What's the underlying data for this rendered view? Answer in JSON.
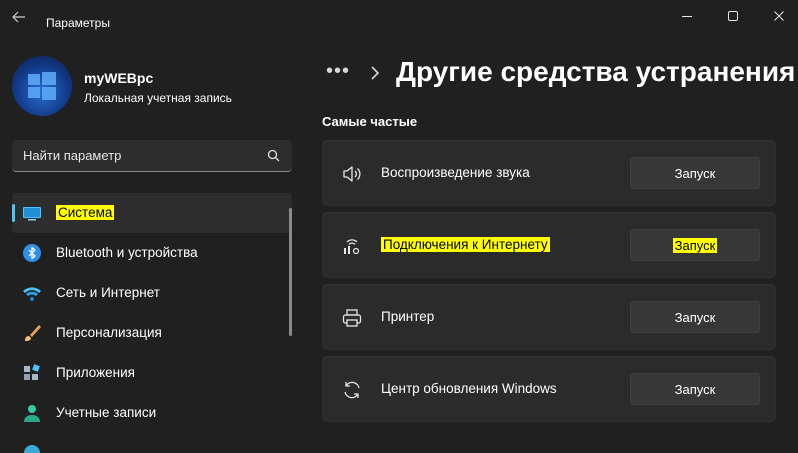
{
  "window": {
    "title": "Параметры"
  },
  "user": {
    "name": "myWEBpc",
    "account_type": "Локальная учетная запись"
  },
  "search": {
    "placeholder": "Найти параметр"
  },
  "sidebar": {
    "items": [
      {
        "label": "Система",
        "icon": "monitor-icon",
        "active": true,
        "highlighted": true
      },
      {
        "label": "Bluetooth и устройства",
        "icon": "bluetooth-icon",
        "active": false,
        "highlighted": false
      },
      {
        "label": "Сеть и Интернет",
        "icon": "wifi-icon",
        "active": false,
        "highlighted": false
      },
      {
        "label": "Персонализация",
        "icon": "brush-icon",
        "active": false,
        "highlighted": false
      },
      {
        "label": "Приложения",
        "icon": "apps-icon",
        "active": false,
        "highlighted": false
      },
      {
        "label": "Учетные записи",
        "icon": "account-icon",
        "active": false,
        "highlighted": false
      }
    ]
  },
  "breadcrumb": {
    "dots": "•••",
    "page_title": "Другие средства устранения"
  },
  "section": {
    "title": "Самые частые"
  },
  "troubleshooters": [
    {
      "label": "Воспроизведение звука",
      "icon": "speaker-icon",
      "button": "Запуск",
      "highlighted": false
    },
    {
      "label": "Подключения к Интернету",
      "icon": "network-icon",
      "button": "Запуск",
      "highlighted": true
    },
    {
      "label": "Принтер",
      "icon": "printer-icon",
      "button": "Запуск",
      "highlighted": false
    },
    {
      "label": "Центр обновления Windows",
      "icon": "refresh-icon",
      "button": "Запуск",
      "highlighted": false
    }
  ],
  "colors": {
    "background": "#202020",
    "card": "#2b2b2b",
    "accent": "#4cc2ff",
    "highlight": "#ffff00"
  }
}
